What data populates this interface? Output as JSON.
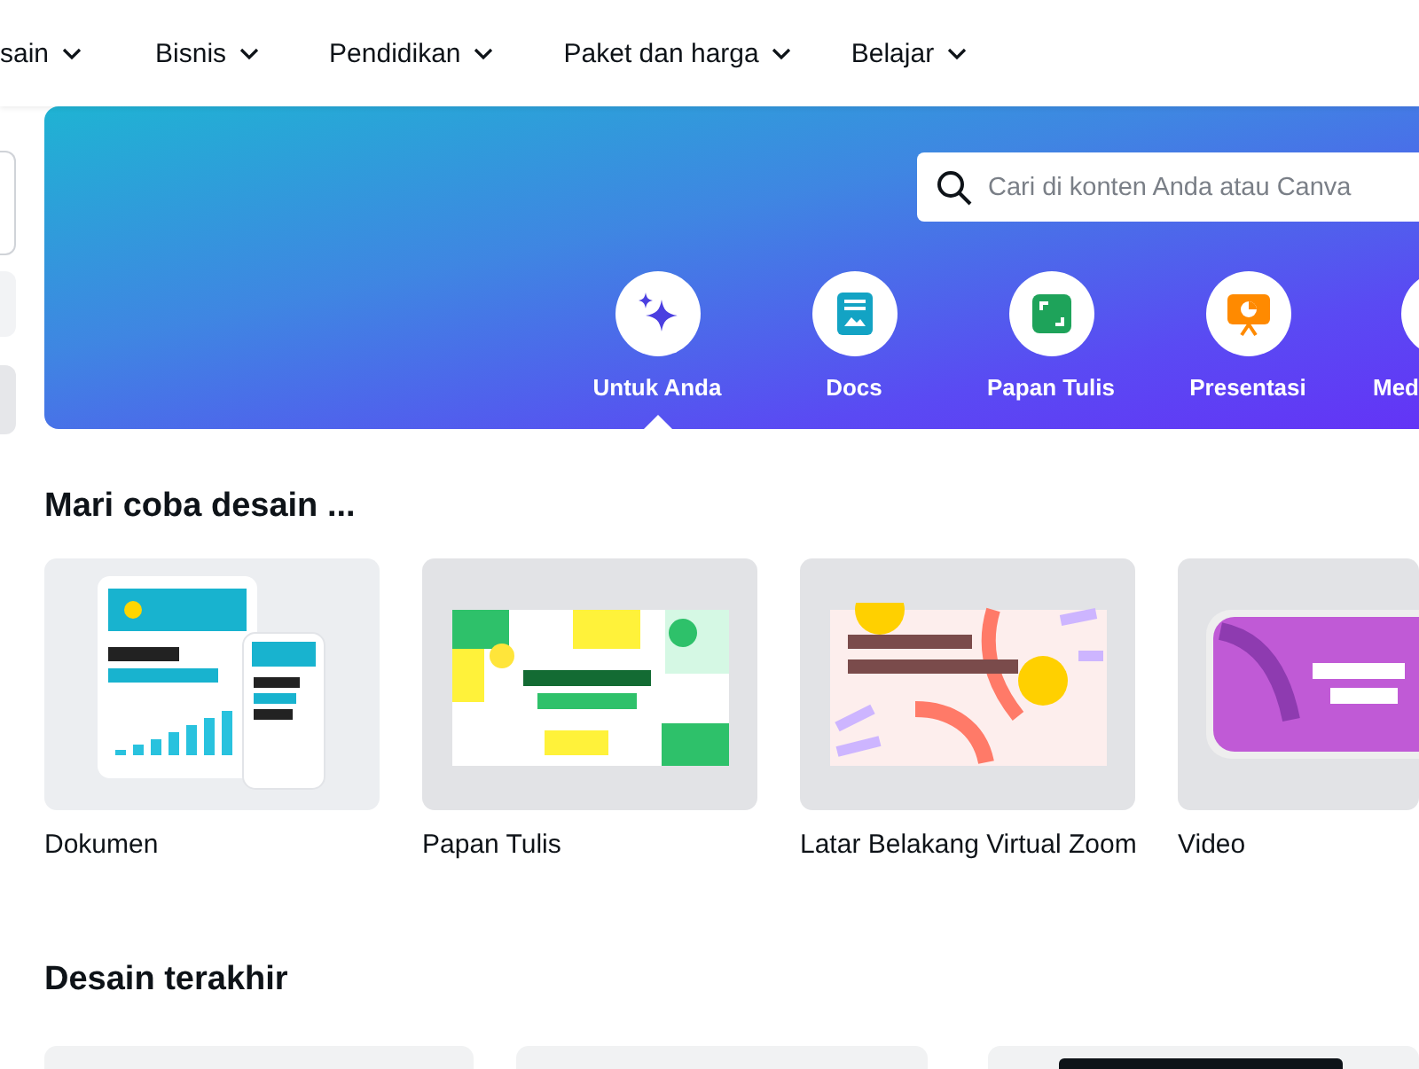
{
  "nav": {
    "items": [
      {
        "label": "sain"
      },
      {
        "label": "Bisnis"
      },
      {
        "label": "Pendidikan"
      },
      {
        "label": "Paket dan harga"
      },
      {
        "label": "Belajar"
      }
    ]
  },
  "sidebar": {
    "items": [
      {
        "kind": "outlined"
      },
      {
        "kind": "light"
      },
      {
        "kind": "grey"
      }
    ]
  },
  "banner": {
    "search": {
      "placeholder": "Cari di konten Anda atau Canva"
    },
    "categories": [
      {
        "label": "Untuk Anda",
        "kind": "sparkle",
        "selected": true
      },
      {
        "label": "Docs",
        "kind": "docs",
        "selected": false
      },
      {
        "label": "Papan Tulis",
        "kind": "whiteboard",
        "selected": false
      },
      {
        "label": "Presentasi",
        "kind": "presentation",
        "selected": false
      },
      {
        "label": "Med",
        "kind": "media",
        "selected": false
      }
    ]
  },
  "try_section": {
    "title": "Mari coba desain ...",
    "templates": [
      {
        "label": "Dokumen",
        "kind": "document"
      },
      {
        "label": "Papan Tulis",
        "kind": "whiteboard"
      },
      {
        "label": "Latar Belakang Virtual Zoom",
        "kind": "backdrop"
      },
      {
        "label": "Video",
        "kind": "video"
      }
    ]
  },
  "recent_section": {
    "title": "Desain terakhir",
    "designs": [
      {
        "kind": "light"
      },
      {
        "kind": "light"
      },
      {
        "kind": "dark"
      }
    ]
  }
}
